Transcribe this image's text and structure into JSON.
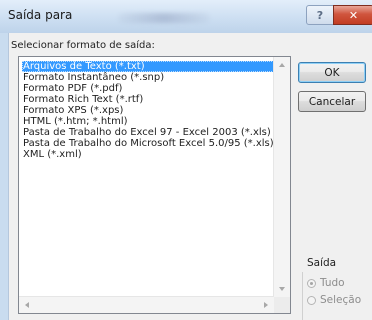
{
  "window": {
    "title": "Saída para",
    "help_glyph": "?",
    "close_glyph": "✕"
  },
  "format_list": {
    "label": "Selecionar formato de saída:",
    "selected_index": 0,
    "items": [
      "Arquivos de Texto (*.txt)",
      "Formato Instantâneo (*.snp)",
      "Formato PDF (*.pdf)",
      "Formato Rich Text (*.rtf)",
      "Formato XPS (*.xps)",
      "HTML (*.htm; *.html)",
      "Pasta de Trabalho do Excel 97 - Excel 2003 (*.xls)",
      "Pasta de Trabalho do Microsoft Excel 5.0/95 (*.xls)",
      "XML (*.xml)"
    ]
  },
  "buttons": {
    "ok": "OK",
    "cancel": "Cancelar"
  },
  "output_group": {
    "label": "Saída",
    "options": [
      {
        "label": "Tudo",
        "checked": true,
        "enabled": false
      },
      {
        "label": "Seleção",
        "checked": false,
        "enabled": false
      }
    ]
  },
  "colors": {
    "selection": "#3399ff",
    "close_button": "#c7432a",
    "title_bar": "#cddff2"
  }
}
